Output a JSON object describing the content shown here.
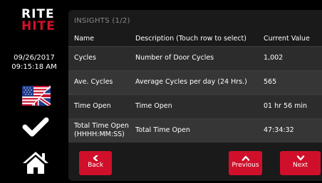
{
  "brand": {
    "line1": "RITE",
    "line2": "HITE"
  },
  "status": {
    "date": "09/26/2017",
    "time": "09:15:18 AM"
  },
  "panel": {
    "title": "INSIGHTS (1/2)"
  },
  "table": {
    "headers": [
      "Name",
      "Description (Touch row to select)",
      "Current Value"
    ],
    "rows": [
      {
        "name": "Cycles",
        "description": "Number of Door Cycles",
        "value": "1,002"
      },
      {
        "name": "Ave. Cycles",
        "description": "Average Cycles per day (24 Hrs.)",
        "value": "565"
      },
      {
        "name": "Time Open",
        "description": "Time Open",
        "value": "01 hr 56 min"
      },
      {
        "name": "Total Time Open (HHHH:MM:SS)",
        "description": "Total Time Open",
        "value": "47:34:32"
      }
    ]
  },
  "buttons": {
    "back": "Back",
    "previous": "Previous",
    "next": "Next"
  },
  "icons": {
    "language": "uk-us-flag-icon",
    "confirm": "checkmark-icon",
    "home": "home-icon"
  },
  "colors": {
    "accent": "#d0102a",
    "panel": "#1a1a1a",
    "row_odd": "#2c2c2c",
    "row_even": "#363636"
  }
}
